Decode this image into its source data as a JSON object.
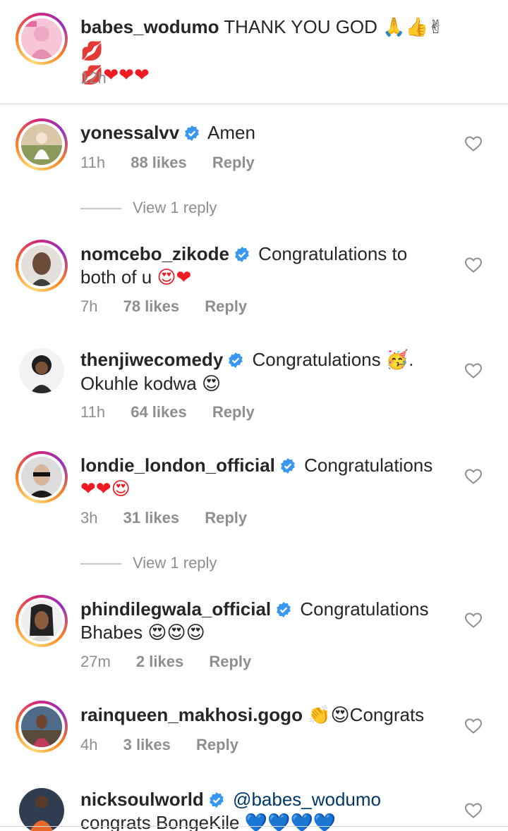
{
  "caption": {
    "username": "babes_wodumo",
    "text": "THANK YOU GOD",
    "emojis_line1": "🙏👍✌💋",
    "emojis_line2": "💋❤❤❤",
    "time": "12h"
  },
  "comments": [
    {
      "username": "yonessalvv",
      "verified": true,
      "text": "Amen",
      "time": "11h",
      "likes": "88 likes",
      "reply": "Reply",
      "view_replies": "View 1 reply"
    },
    {
      "username": "nomcebo_zikode",
      "verified": true,
      "text": "Congratulations to",
      "text2": "both of u",
      "emojis": "😍❤",
      "time": "7h",
      "likes": "78 likes",
      "reply": "Reply"
    },
    {
      "username": "thenjiwecomedy",
      "verified": true,
      "text": "Congratulations",
      "emoji_a": "🥳",
      "text_dot": ".",
      "text2": "Okuhle kodwa",
      "emojis": "😍",
      "time": "11h",
      "likes": "64 likes",
      "reply": "Reply"
    },
    {
      "username": "londie_london_official",
      "verified": true,
      "text": "Congratulations",
      "emojis": "❤❤😍",
      "time": "3h",
      "likes": "31 likes",
      "reply": "Reply",
      "view_replies": "View 1 reply"
    },
    {
      "username": "phindilegwala_official",
      "verified": true,
      "text": "Congratulations",
      "text2": "Bhabes",
      "emojis": "😍😍😍",
      "time": "27m",
      "likes": "2 likes",
      "reply": "Reply"
    },
    {
      "username": "rainqueen_makhosi.gogo",
      "verified": false,
      "emojis": "👏😍",
      "text": "Congrats",
      "time": "4h",
      "likes": "3 likes",
      "reply": "Reply"
    },
    {
      "username": "nicksoulworld",
      "verified": true,
      "mention": "@babes_wodumo",
      "text2": "congrats BongeKile",
      "emojis": "💙💙💙💙"
    }
  ],
  "colors": {
    "text": "#262626",
    "secondary": "#8e8e8e",
    "verified_blue": "#3897f0",
    "mention_blue": "#00376b",
    "heart_red": "#ed1c24"
  }
}
